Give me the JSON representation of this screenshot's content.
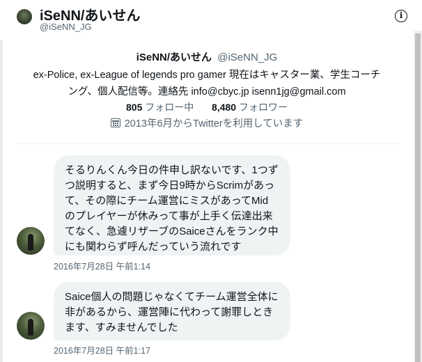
{
  "header": {
    "display_name": "iSeNN/あいせん",
    "handle": "@iSeNN_JG",
    "info_icon_glyph": "i"
  },
  "profile": {
    "display_name": "iSeNN/あいせん",
    "handle": "@iSeNN_JG",
    "bio_line1": "ex-Police, ex-League of legends pro gamer 現在はキャスター業、学生コーチ",
    "bio_line2": "ング、個人配信等。連絡先 info@cbyc.jp isenn1jg@gmail.com",
    "following_count": "805",
    "following_label": "フォロー中",
    "followers_count": "8,480",
    "followers_label": "フォロワー",
    "joined_text": "2013年6月からTwitterを利用しています"
  },
  "messages": [
    {
      "lines": [
        "そるりんくん今日の件申し訳ないです、1つず",
        "つ説明すると、まず今日9時からScrimがあっ",
        "て、その際にチーム運営にミスがあってMid",
        "のプレイヤーが休みって事が上手く伝達出来",
        "てなく、急遽リザーブのSaiceさんをランク中",
        "にも関わらず呼んだっていう流れです"
      ],
      "timestamp": "2016年7月28日 午前1:14"
    },
    {
      "lines": [
        "Saice個人の問題じゃなくてチーム運営全体に",
        "非があるから、運営陣に代わって謝罪しとき",
        "ます、すみませんでした"
      ],
      "timestamp": "2016年7月28日 午前1:17"
    }
  ],
  "colors": {
    "bubble_bg": "#eff3f4",
    "secondary_text": "#536471",
    "primary_text": "#0f1419"
  }
}
